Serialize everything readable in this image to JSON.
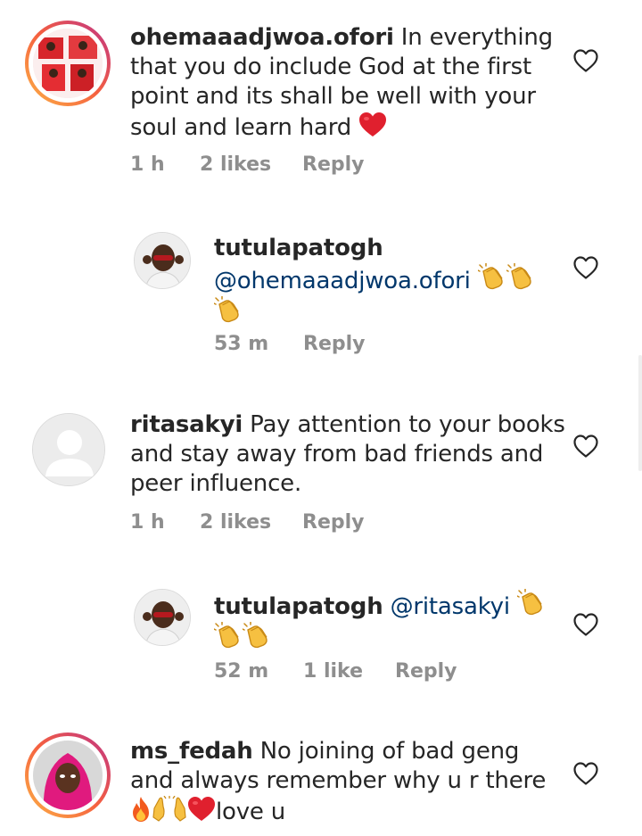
{
  "comments": [
    {
      "username": "ohemaaadjwoa.ofori",
      "text_line1": " In everything",
      "text_line2": "that you do include God at the first",
      "text_line3": "point and its shall be well with your",
      "text_line4": "soul and learn hard",
      "time": "1 h",
      "likes": "2 likes",
      "reply": "Reply"
    },
    {
      "username": "tutulapatogh",
      "mention": "@ohemaaadjwoa.ofori",
      "time": "53 m",
      "reply": "Reply"
    },
    {
      "username": "ritasakyi",
      "text_line1": " Pay attention to your books",
      "text_line2": "and stay away from bad friends and",
      "text_line3": "peer influence.",
      "time": "1 h",
      "likes": "2 likes",
      "reply": "Reply"
    },
    {
      "username": "tutulapatogh",
      "mention": "@ritasakyi",
      "time": "52 m",
      "likes": "1 like",
      "reply": "Reply"
    },
    {
      "username": "ms_fedah",
      "text_line1": " No joining of bad geng",
      "text_line2": "and always remember why u r there",
      "text_line3_suffix": "love u"
    }
  ],
  "icons": {
    "heart": "heart-outline-icon",
    "clap": "clapping-hands-emoji",
    "red_heart": "red-heart-emoji",
    "fire": "fire-emoji",
    "raised_hands": "raised-hands-emoji"
  },
  "colors": {
    "text": "#262626",
    "meta": "#8e8e8e",
    "mention": "#00376b",
    "story_ring_start": "#f9a825",
    "story_ring_end": "#d81b60"
  }
}
